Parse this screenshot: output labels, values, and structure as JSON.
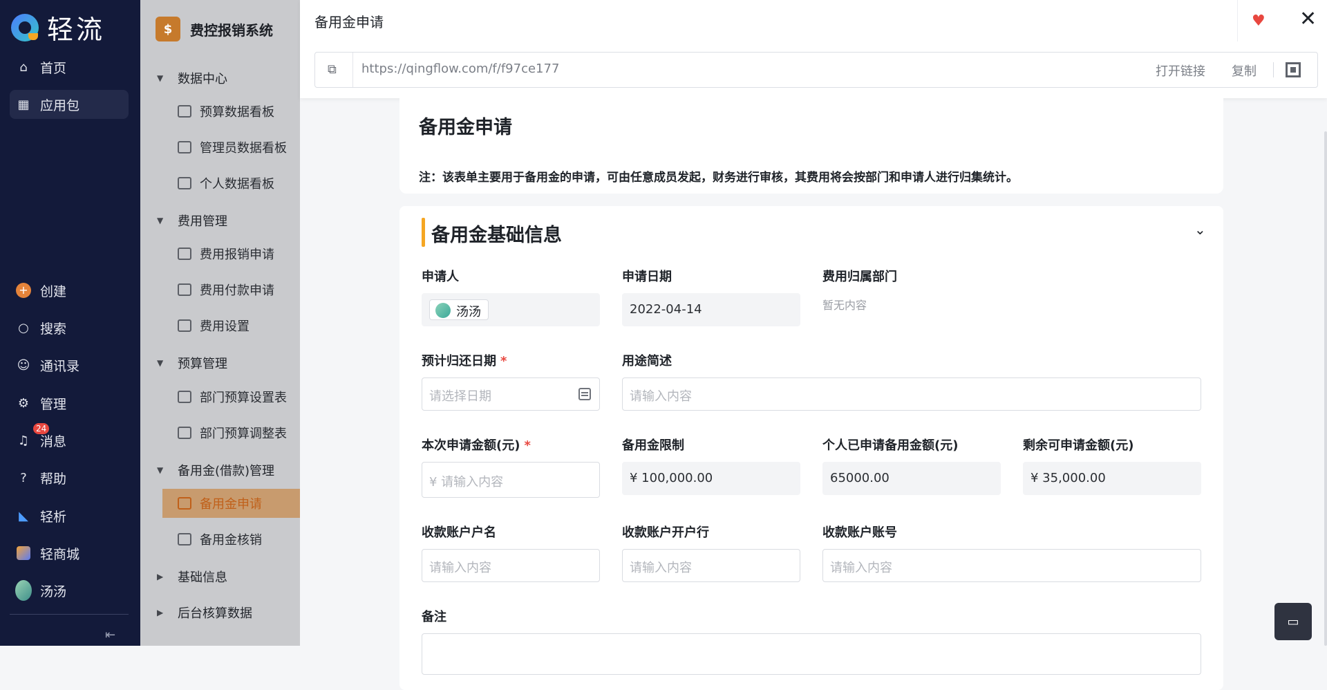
{
  "nav": {
    "brand": "轻流",
    "items": [
      {
        "label": "首页",
        "icon": "home-icon"
      },
      {
        "label": "应用包",
        "icon": "apps-icon"
      },
      {
        "label": "创建",
        "icon": "plus-icon"
      },
      {
        "label": "搜索",
        "icon": "search-icon"
      },
      {
        "label": "通讯录",
        "icon": "contacts-icon"
      },
      {
        "label": "管理",
        "icon": "gear-icon"
      },
      {
        "label": "消息",
        "icon": "bell-icon",
        "badge": "24"
      },
      {
        "label": "帮助",
        "icon": "help-icon"
      },
      {
        "label": "轻析",
        "icon": "analytics-icon"
      },
      {
        "label": "轻商城",
        "icon": "store-icon"
      },
      {
        "label": "汤汤",
        "icon": "avatar"
      }
    ]
  },
  "sidebar": {
    "title": "费控报销系统",
    "groups": [
      {
        "label": "数据中心",
        "items": [
          "预算数据看板",
          "管理员数据看板",
          "个人数据看板"
        ]
      },
      {
        "label": "费用管理",
        "items": [
          "费用报销申请",
          "费用付款申请",
          "费用设置"
        ]
      },
      {
        "label": "预算管理",
        "items": [
          "部门预算设置表",
          "部门预算调整表"
        ]
      },
      {
        "label": "备用金(借款)管理",
        "items": [
          "备用金申请",
          "备用金核销"
        ]
      },
      {
        "label": "基础信息",
        "items": []
      },
      {
        "label": "后台核算数据",
        "items": []
      }
    ]
  },
  "modal": {
    "title": "备用金申请",
    "url": "https://qingflow.com/f/f97ce177",
    "open_link": "打开链接",
    "copy": "复制"
  },
  "form": {
    "title": "备用金申请",
    "note": "注：该表单主要用于备用金的申请，可由任意成员发起，财务进行审核，其费用将会按部门和申请人进行归集统计。",
    "section_title": "备用金基础信息",
    "applicant": {
      "label": "申请人",
      "value": "汤汤"
    },
    "apply_date": {
      "label": "申请日期",
      "value": "2022-04-14"
    },
    "department": {
      "label": "费用归属部门",
      "value": "暂无内容"
    },
    "return_date": {
      "label": "预计归还日期",
      "required": "*",
      "placeholder": "请选择日期"
    },
    "purpose": {
      "label": "用途简述",
      "placeholder": "请输入内容"
    },
    "amount": {
      "label": "本次申请金额(元)",
      "required": "*",
      "placeholder": "¥ 请输入内容"
    },
    "limit": {
      "label": "备用金限制",
      "value": "¥ 100,000.00"
    },
    "applied": {
      "label": "个人已申请备用金额(元)",
      "value": "65000.00"
    },
    "remaining": {
      "label": "剩余可申请金额(元)",
      "value": "¥ 35,000.00"
    },
    "account_name": {
      "label": "收款账户户名",
      "placeholder": "请输入内容"
    },
    "bank": {
      "label": "收款账户开户行",
      "placeholder": "请输入内容"
    },
    "account_no": {
      "label": "收款账户账号",
      "placeholder": "请输入内容"
    },
    "remark": {
      "label": "备注"
    }
  }
}
